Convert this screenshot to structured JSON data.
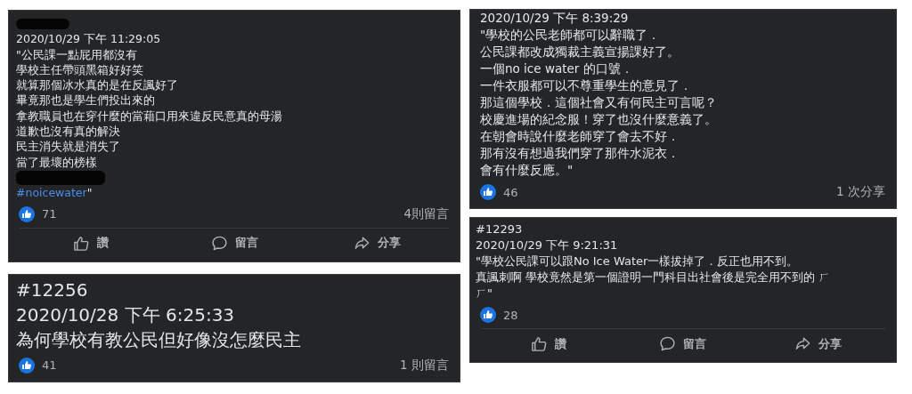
{
  "columns": [
    {
      "cards": [
        {
          "lines": [
            {
              "kind": "redacted"
            },
            {
              "kind": "timestamp",
              "text": "2020/10/29 下午 11:29:05"
            },
            {
              "kind": "text",
              "text": "\"公民課一點屁用都沒有"
            },
            {
              "kind": "text",
              "text": "學校主任帶頭黑箱好好笑"
            },
            {
              "kind": "text",
              "text": "就算那個冰水真的是在反諷好了"
            },
            {
              "kind": "text",
              "text": "畢竟那也是學生們投出來的"
            },
            {
              "kind": "text",
              "text": "拿教職員也在穿什麼的當藉口用來違反民意真的母湯"
            },
            {
              "kind": "text",
              "text": "道歉也沒有真的解決"
            },
            {
              "kind": "text",
              "text": "民主消失就是消失了"
            },
            {
              "kind": "text",
              "text": "當了最壞的榜樣"
            },
            {
              "kind": "redacted"
            },
            {
              "kind": "hashtag",
              "text": "#noicewater",
              "suffix": "\""
            }
          ],
          "likes": "71",
          "stat": "4則留言",
          "actions": [
            {
              "kind": "like",
              "label": "讚"
            },
            {
              "kind": "comment",
              "label": "留言"
            },
            {
              "kind": "share",
              "label": "分享"
            }
          ]
        },
        {
          "lines": [
            {
              "kind": "number",
              "text": "#12256"
            },
            {
              "kind": "timestamp",
              "text": "2020/10/28 下午 6:25:33"
            },
            {
              "kind": "text",
              "text": "為何學校有教公民但好像沒怎麼民主"
            }
          ],
          "likes": "41",
          "stat": "1 則留言"
        }
      ]
    },
    {
      "cards": [
        {
          "lines": [
            {
              "kind": "timestamp",
              "text": "2020/10/29 下午 8:39:29"
            },
            {
              "kind": "text",
              "text": "\"學校的公民老師都可以辭職了．"
            },
            {
              "kind": "text",
              "text": "公民課都改成獨裁主義宣揚課好了。"
            },
            {
              "kind": "text",
              "text": "一個no ice water 的口號．"
            },
            {
              "kind": "text",
              "text": "一件衣服都可以不尊重學生的意見了．"
            },
            {
              "kind": "text",
              "text": "那這個學校．這個社會又有何民主可言呢？"
            },
            {
              "kind": "text",
              "text": "校慶進場的紀念服！穿了也沒什麼意義了。"
            },
            {
              "kind": "text",
              "text": "在朝會時說什麼老師穿了會去不好．"
            },
            {
              "kind": "text",
              "text": "那有沒有想過我們穿了那件水泥衣．"
            },
            {
              "kind": "text",
              "text": "會有什麼反應。\""
            }
          ],
          "likes": "46",
          "stat": "1 次分享"
        },
        {
          "lines": [
            {
              "kind": "number",
              "text": "#12293"
            },
            {
              "kind": "timestamp",
              "text": "2020/10/29 下午 9:21:31"
            },
            {
              "kind": "text",
              "text": "\"學校公民課可以跟No Ice Water一樣拔掉了．反正也用不到。"
            },
            {
              "kind": "text",
              "text": "真諷刺啊 學校竟然是第一個證明一門科目出社會後是完全用不到的 ㄏ"
            },
            {
              "kind": "text",
              "text": "ㄏ\""
            }
          ],
          "likes": "28",
          "actions": [
            {
              "kind": "like",
              "label": "讚"
            },
            {
              "kind": "comment",
              "label": "留言"
            },
            {
              "kind": "share",
              "label": "分享"
            }
          ]
        }
      ]
    }
  ]
}
